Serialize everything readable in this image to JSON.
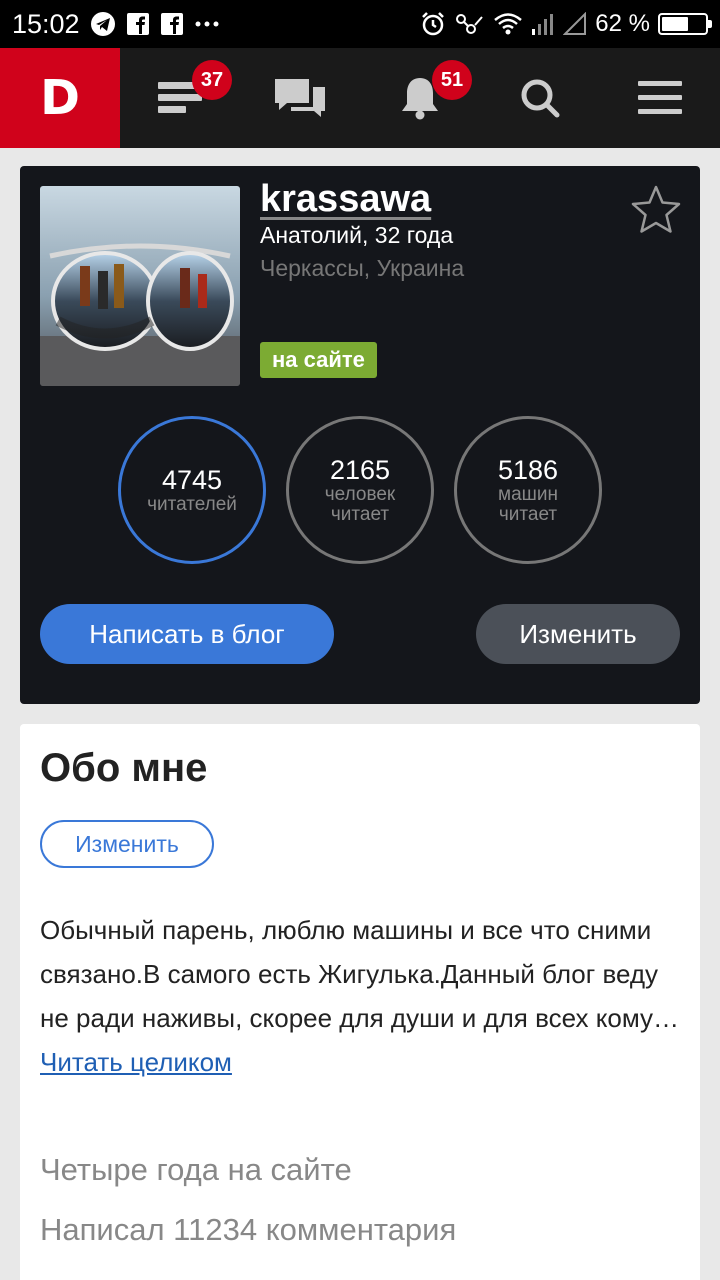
{
  "status_bar": {
    "time": "15:02",
    "battery": "62 %",
    "battery_level": 0.62
  },
  "nav": {
    "logo": "D",
    "feed_badge": "37",
    "notifications_badge": "51"
  },
  "profile": {
    "username": "krassawa",
    "name_age": "Анатолий, 32 года",
    "location": "Черкассы, Украина",
    "online_status": "на сайте",
    "stats": [
      {
        "value": "4745",
        "label_line1": "читателей",
        "label_line2": ""
      },
      {
        "value": "2165",
        "label_line1": "человек",
        "label_line2": "читает"
      },
      {
        "value": "5186",
        "label_line1": "машин",
        "label_line2": "читает"
      }
    ],
    "write_button": "Написать в блог",
    "edit_button": "Изменить"
  },
  "about": {
    "title": "Обо мне",
    "edit_button": "Изменить",
    "bio_text": "Обычный парень, люблю машины и все что сними связано.В самого есть Жигулька.Данный блог веду не ради наживы, скорее для души и для всех кому…",
    "read_more": "Читать целиком",
    "years_on_site": "Четыре года на сайте",
    "comments_count": "Написал 11234 комментария"
  },
  "colors": {
    "brand_red": "#d0021b",
    "accent_blue": "#3a78d8",
    "online_green": "#7cab33",
    "card_dark": "#14161b"
  }
}
